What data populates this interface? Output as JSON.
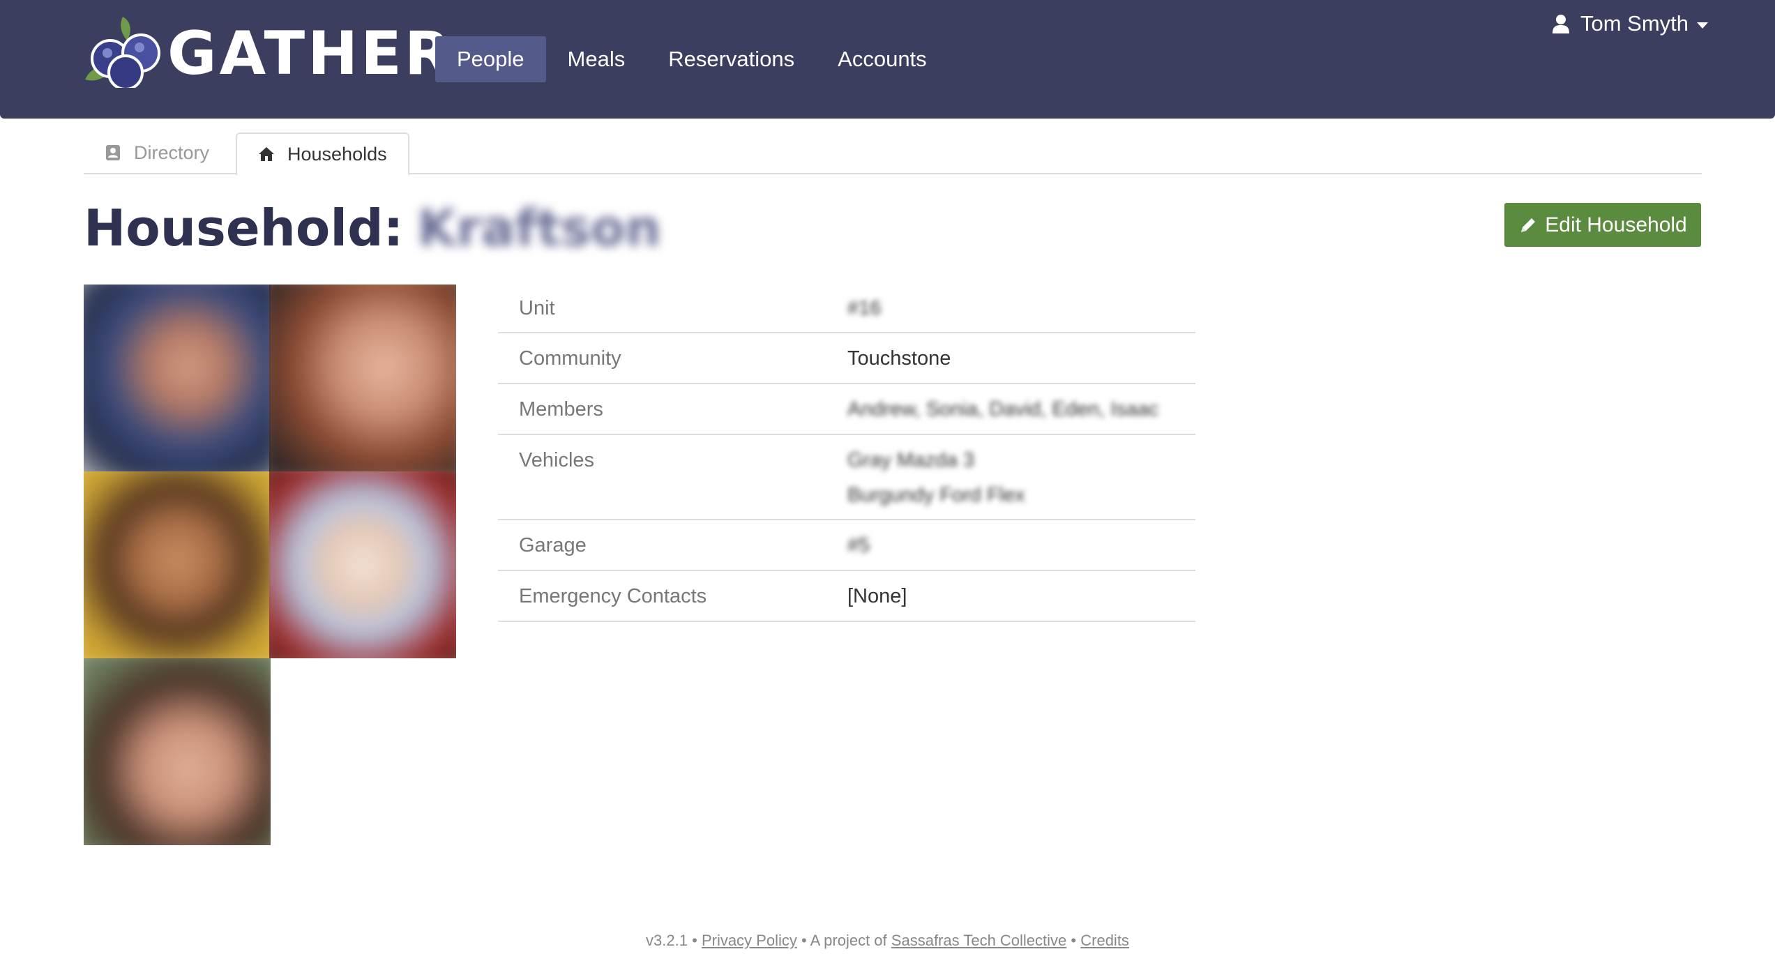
{
  "brand": {
    "name": "GATHER"
  },
  "nav": {
    "items": [
      {
        "label": "People",
        "active": true
      },
      {
        "label": "Meals",
        "active": false
      },
      {
        "label": "Reservations",
        "active": false
      },
      {
        "label": "Accounts",
        "active": false
      }
    ],
    "user": {
      "name": "Tom Smyth",
      "icon": "user-icon"
    }
  },
  "tabs": {
    "directory": {
      "label": "Directory",
      "icon": "address-book-icon"
    },
    "households": {
      "label": "Households",
      "icon": "home-icon",
      "active": true
    }
  },
  "page": {
    "title_prefix": "Household:",
    "household_name": "Kraftson",
    "edit_button": "Edit Household"
  },
  "details": {
    "unit": {
      "label": "Unit",
      "value": "#16"
    },
    "community": {
      "label": "Community",
      "value": "Touchstone"
    },
    "members": {
      "label": "Members",
      "value": "Andrew, Sonia, David, Eden, Isaac"
    },
    "vehicles": {
      "label": "Vehicles",
      "values": [
        "Gray Mazda 3",
        "Burgundy Ford Flex"
      ]
    },
    "garage": {
      "label": "Garage",
      "value": "#5"
    },
    "emergency": {
      "label": "Emergency Contacts",
      "value": "[None]"
    }
  },
  "footer": {
    "version": "v3.2.1",
    "sep": "•",
    "privacy": "Privacy Policy",
    "project_of": "A project of",
    "collective": "Sassafras Tech Collective",
    "credits": "Credits"
  },
  "colors": {
    "navbar": "#3b3e5f",
    "nav_active": "#545a89",
    "title": "#2e3150",
    "edit_button": "#5b8b3f"
  }
}
